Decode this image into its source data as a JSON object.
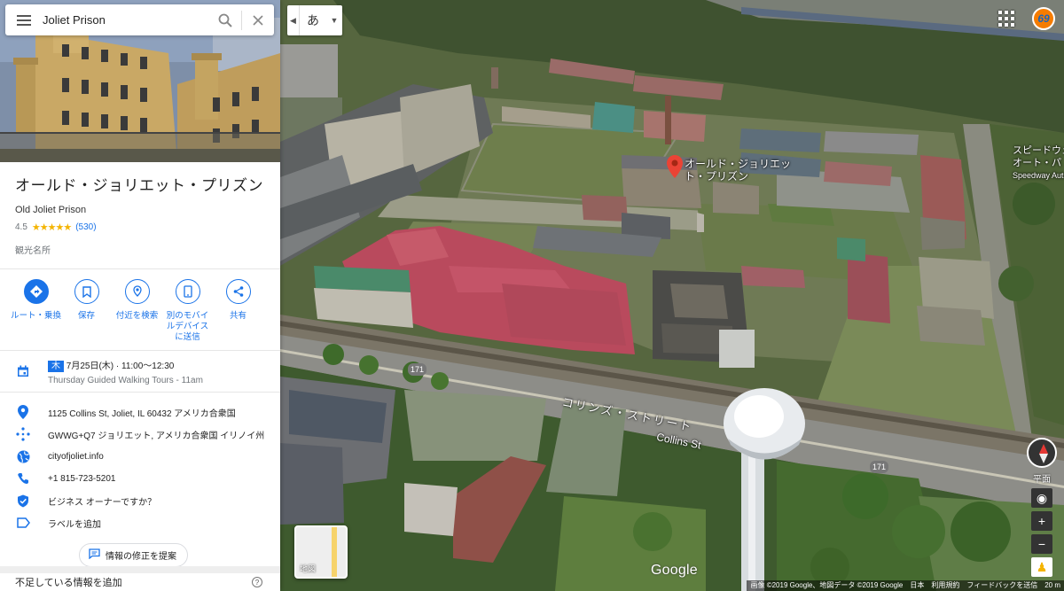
{
  "search": {
    "query": "Joliet Prison"
  },
  "place": {
    "title_ja": "オールド・ジョリエット・プリズン",
    "title_en": "Old Joliet Prison",
    "rating": "4.5",
    "stars": "★★★★★",
    "review_count": "(530)",
    "category": "観光名所"
  },
  "actions": [
    {
      "label": "ルート・乗換",
      "icon": "directions-icon"
    },
    {
      "label": "保存",
      "icon": "bookmark-icon"
    },
    {
      "label": "付近を検索",
      "icon": "nearby-icon"
    },
    {
      "label": "別のモバイルデバイスに送信",
      "icon": "send-to-phone-icon"
    },
    {
      "label": "共有",
      "icon": "share-icon"
    }
  ],
  "hours": {
    "day_badge": "木",
    "date_time": "7月25日(木) · 11:00～12:30",
    "event": "Thursday Guided Walking Tours - 11am"
  },
  "info": {
    "address": "1125 Collins St, Joliet, IL 60432 アメリカ合衆国",
    "plus_code": "GWWG+Q7 ジョリエット, アメリカ合衆国 イリノイ州",
    "website": "cityofjoliet.info",
    "phone": "+1 815-723-5201",
    "claim": "ビジネス オーナーですか？",
    "add_label": "ラベルを追加"
  },
  "suggest_edit": "情報の修正を提案",
  "missing_info": "不足している情報を追加",
  "map": {
    "ime_char": "あ",
    "pin_label": "オールド・ジョリエット・プリズン",
    "road_ja": "コリンズ・ストリート",
    "road_en": "Collins St",
    "route_shield_1": "171",
    "route_shield_2": "171",
    "poi_right_1": "スピードウェイ",
    "poi_right_2": "オート・パ",
    "poi_right_3": "Speedway Auto",
    "badge": "69",
    "minimap_label": "地図",
    "google": "Google",
    "flat_view": "平面",
    "zoom_in": "+",
    "zoom_out": "−",
    "attribution": [
      "画像 ©2019 Google、地図データ ©2019 Google",
      "日本",
      "利用規約",
      "フィードバックを送信",
      "20 m"
    ]
  },
  "colors": {
    "accent": "#1a73e8",
    "star": "#f4b400",
    "pin": "#ea4335",
    "roof_red": "#b84a5a",
    "roof_green": "#4a8a6a"
  }
}
